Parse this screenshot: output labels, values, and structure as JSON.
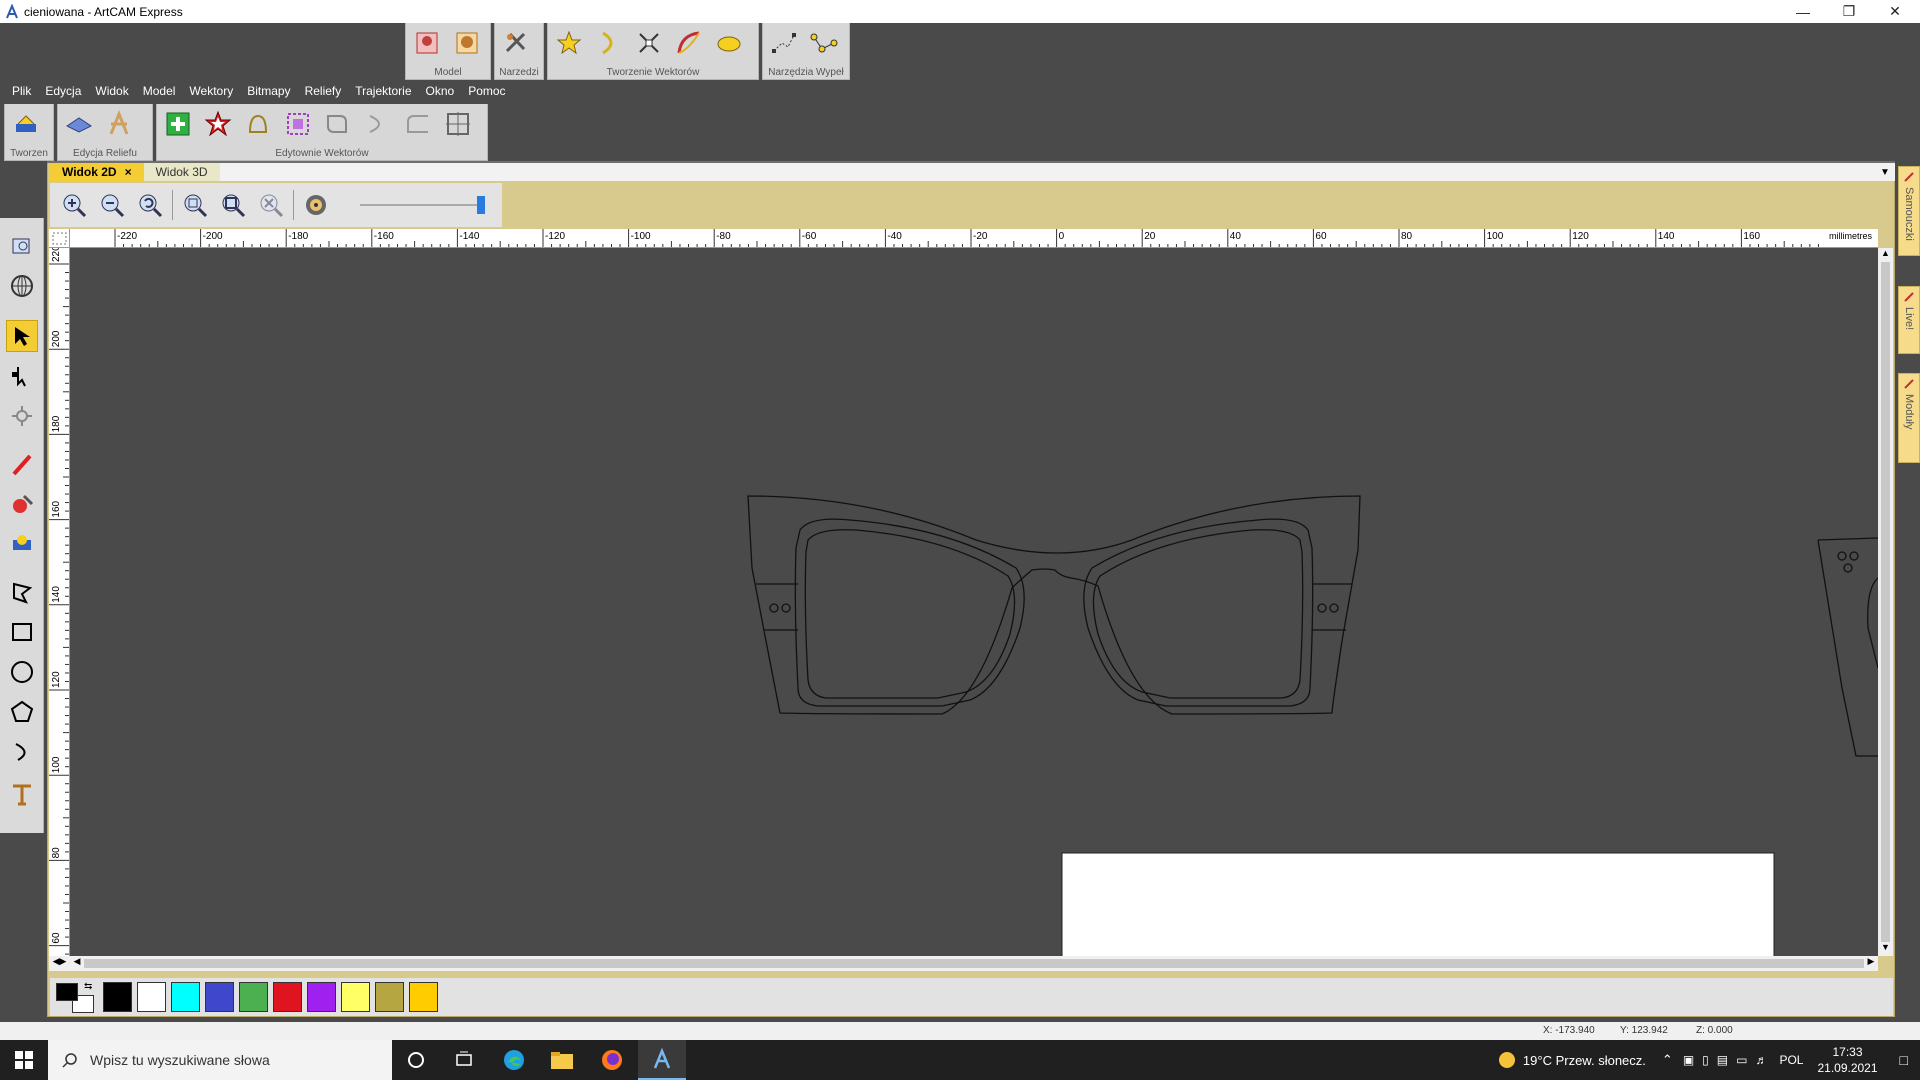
{
  "window": {
    "title": "cieniowana - ArtCAM Express",
    "controls": [
      "minimize-icon",
      "restore-icon",
      "close-icon"
    ]
  },
  "top_groups": [
    {
      "label": "Model",
      "icons": [
        "model-relief-icon",
        "model-bear-icon"
      ]
    },
    {
      "label": "Narzedzi",
      "icons": [
        "tools-icon"
      ]
    },
    {
      "label": "Tworzenie Wektorów",
      "icons": [
        "star-vector-icon",
        "arc-vector-icon",
        "node-scissors-icon",
        "bezier-icon",
        "ellipse-vector-icon"
      ]
    },
    {
      "label": "Narzędzia Wypeł",
      "icons": [
        "fill-nodes-icon",
        "node-path-icon"
      ]
    }
  ],
  "menu": [
    "Plik",
    "Edycja",
    "Widok",
    "Model",
    "Wektory",
    "Bitmapy",
    "Reliefy",
    "Trajektorie",
    "Okno",
    "Pomoc"
  ],
  "toolbar2_groups": [
    {
      "label": "Tworzen",
      "icons": [
        "create-relief-icon"
      ]
    },
    {
      "label": "Edycja Reliefu",
      "icons": [
        "relief-plane-icon",
        "relief-sculpt-icon"
      ]
    },
    {
      "label": "Edytownie Wektorów",
      "icons": [
        "join-vectors-icon",
        "offset-vectors-icon",
        "bell-vector-icon",
        "group-vectors-icon",
        "rounded-corner-icon",
        "arc-fit-icon",
        "fillet-icon",
        "align-vectors-icon"
      ]
    }
  ],
  "tabs": [
    {
      "label": "Widok 2D",
      "active": true
    },
    {
      "label": "Widok 3D",
      "active": false
    }
  ],
  "view_toolbar": {
    "icons": [
      "zoom-in-icon",
      "zoom-out-icon",
      "zoom-previous-icon",
      "zoom-fit-icon",
      "zoom-box-icon",
      "zoom-reset-icon",
      "display-settings-icon"
    ],
    "slider_value": 1.0
  },
  "ruler": {
    "units": "millimetres",
    "h_ticks": [
      "-220",
      "-200",
      "-180",
      "-160",
      "-140",
      "-120",
      "-100",
      "-80",
      "-60",
      "-40",
      "-20",
      "0",
      "20",
      "40",
      "60",
      "80",
      "100",
      "120",
      "140",
      "160"
    ],
    "v_ticks": [
      "220",
      "200",
      "180",
      "160",
      "140",
      "120",
      "100",
      "80",
      "60"
    ]
  },
  "left_tools": [
    "zoom-window-icon",
    "globe-icon",
    "select-arrow-icon",
    "node-edit-icon",
    "transform-icon",
    "pen-icon",
    "paint-icon",
    "bitmap-icon",
    "polyline-icon",
    "rectangle-icon",
    "circle-icon",
    "polygon-icon",
    "arc-icon",
    "text-icon"
  ],
  "palette": {
    "primary": "#000000",
    "secondary": "#ffffff",
    "colors": [
      "#000000",
      "#ffffff",
      "#00ffff",
      "#3f48cc",
      "#4caf50",
      "#e0141e",
      "#a020f0",
      "#ffff66",
      "#b5a642",
      "#ffcc00"
    ]
  },
  "right_tabs": [
    "Samouczki",
    "Live!",
    "Moduły"
  ],
  "status": {
    "x": "X: -173.940",
    "y": "Y: 123.942",
    "z": "Z: 0.000"
  },
  "taskbar": {
    "search_placeholder": "Wpisz tu wyszukiwane słowa",
    "weather": "19°C  Przew. słonecz.",
    "lang": "POL",
    "time": "17:33",
    "date": "21.09.2021"
  }
}
